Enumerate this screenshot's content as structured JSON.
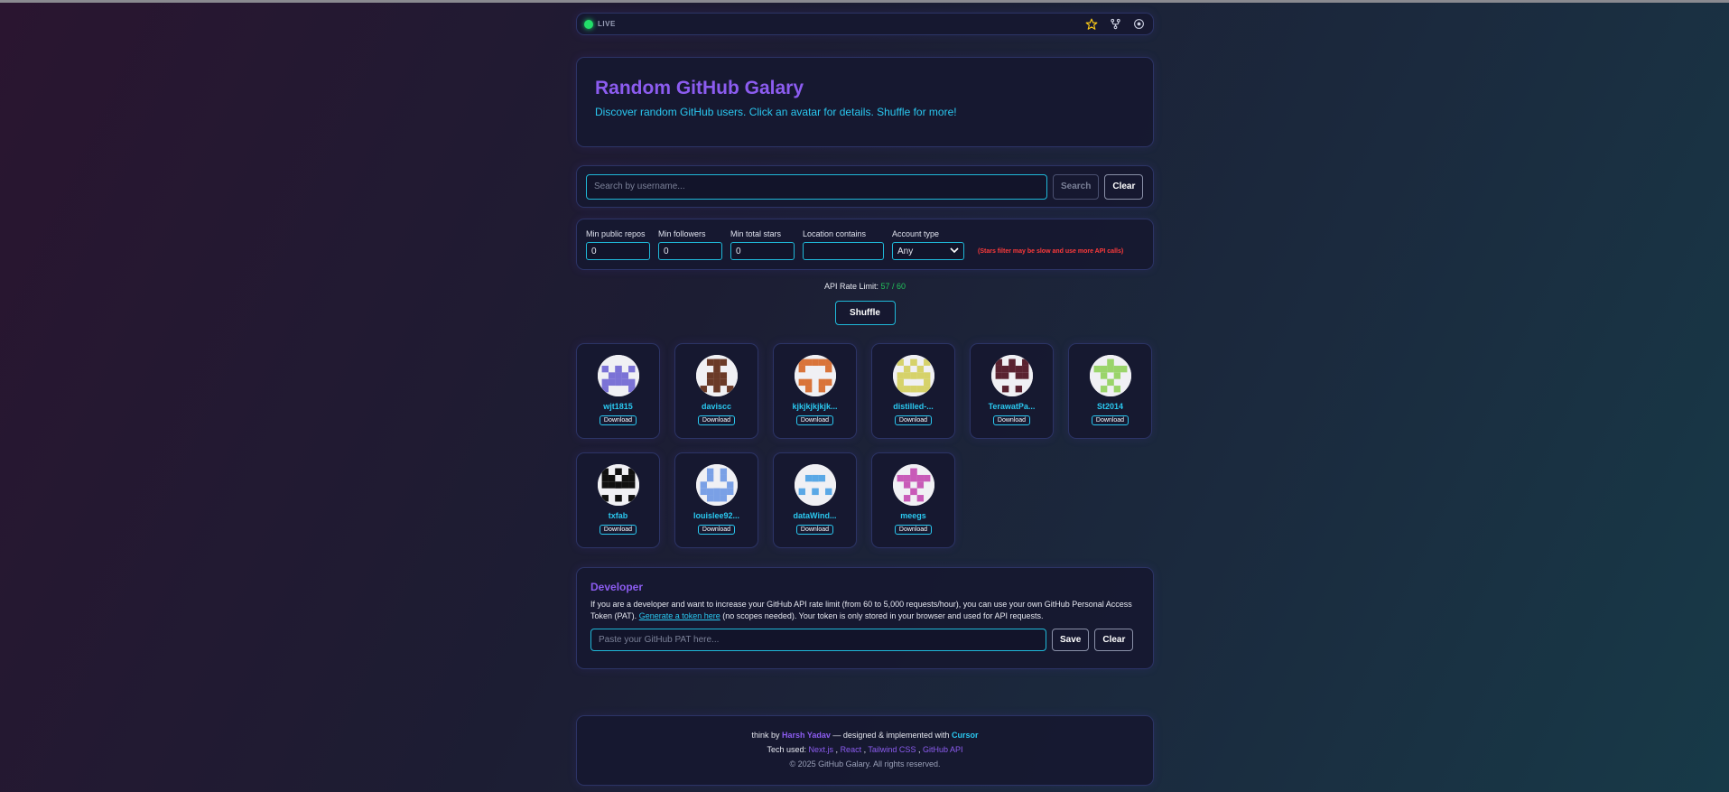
{
  "status": {
    "live_label": "LIVE"
  },
  "hero": {
    "title": "Random GitHub Galary",
    "subtitle": "Discover random GitHub users. Click an avatar for details. Shuffle for more!"
  },
  "search": {
    "placeholder": "Search by username...",
    "search_label": "Search",
    "clear_label": "Clear"
  },
  "filters": {
    "min_repos": {
      "label": "Min public repos",
      "value": "0"
    },
    "min_followers": {
      "label": "Min followers",
      "value": "0"
    },
    "min_stars": {
      "label": "Min total stars",
      "value": "0"
    },
    "location": {
      "label": "Location contains",
      "value": ""
    },
    "account_type": {
      "label": "Account type",
      "value": "Any"
    },
    "warning": "(Stars filter may be slow and use more API calls)"
  },
  "rate_limit": {
    "label": "API Rate Limit:",
    "value": "57 / 60"
  },
  "shuffle_label": "Shuffle",
  "download_label": "Download",
  "users": [
    {
      "name": "wjt1815",
      "color": "#7b72d6"
    },
    {
      "name": "daviscc",
      "color": "#6b3a28"
    },
    {
      "name": "kjkjkjkjkjk...",
      "color": "#d9743a"
    },
    {
      "name": "distilled-...",
      "color": "#d6d26a"
    },
    {
      "name": "TerawatPa...",
      "color": "#5a2230"
    },
    {
      "name": "St2014",
      "color": "#9ad46a"
    },
    {
      "name": "txfab",
      "color": "#111111"
    },
    {
      "name": "louislee92...",
      "color": "#7aa0e6"
    },
    {
      "name": "dataWind...",
      "color": "#5aa8e6"
    },
    {
      "name": "meegs",
      "color": "#c85ab8"
    }
  ],
  "developer": {
    "title": "Developer",
    "text_1": "If you are a developer and want to increase your GitHub API rate limit (from 60 to 5,000 requests/hour), you can use your own GitHub Personal Access Token (PAT).",
    "link": "Generate a token here",
    "text_2": "(no scopes needed). Your token is only stored in your browser and used for API requests.",
    "placeholder": "Paste your GitHub PAT here...",
    "save_label": "Save",
    "clear_label": "Clear"
  },
  "footer": {
    "think_by": "think by",
    "author": "Harsh Yadav",
    "designed": "— designed & implemented with",
    "tool": "Cursor",
    "tech_label": "Tech used:",
    "tech": [
      "Next.js",
      "React",
      "Tailwind CSS",
      "GitHub API"
    ],
    "copyright": "© 2025 GitHub Galary. All rights reserved."
  }
}
